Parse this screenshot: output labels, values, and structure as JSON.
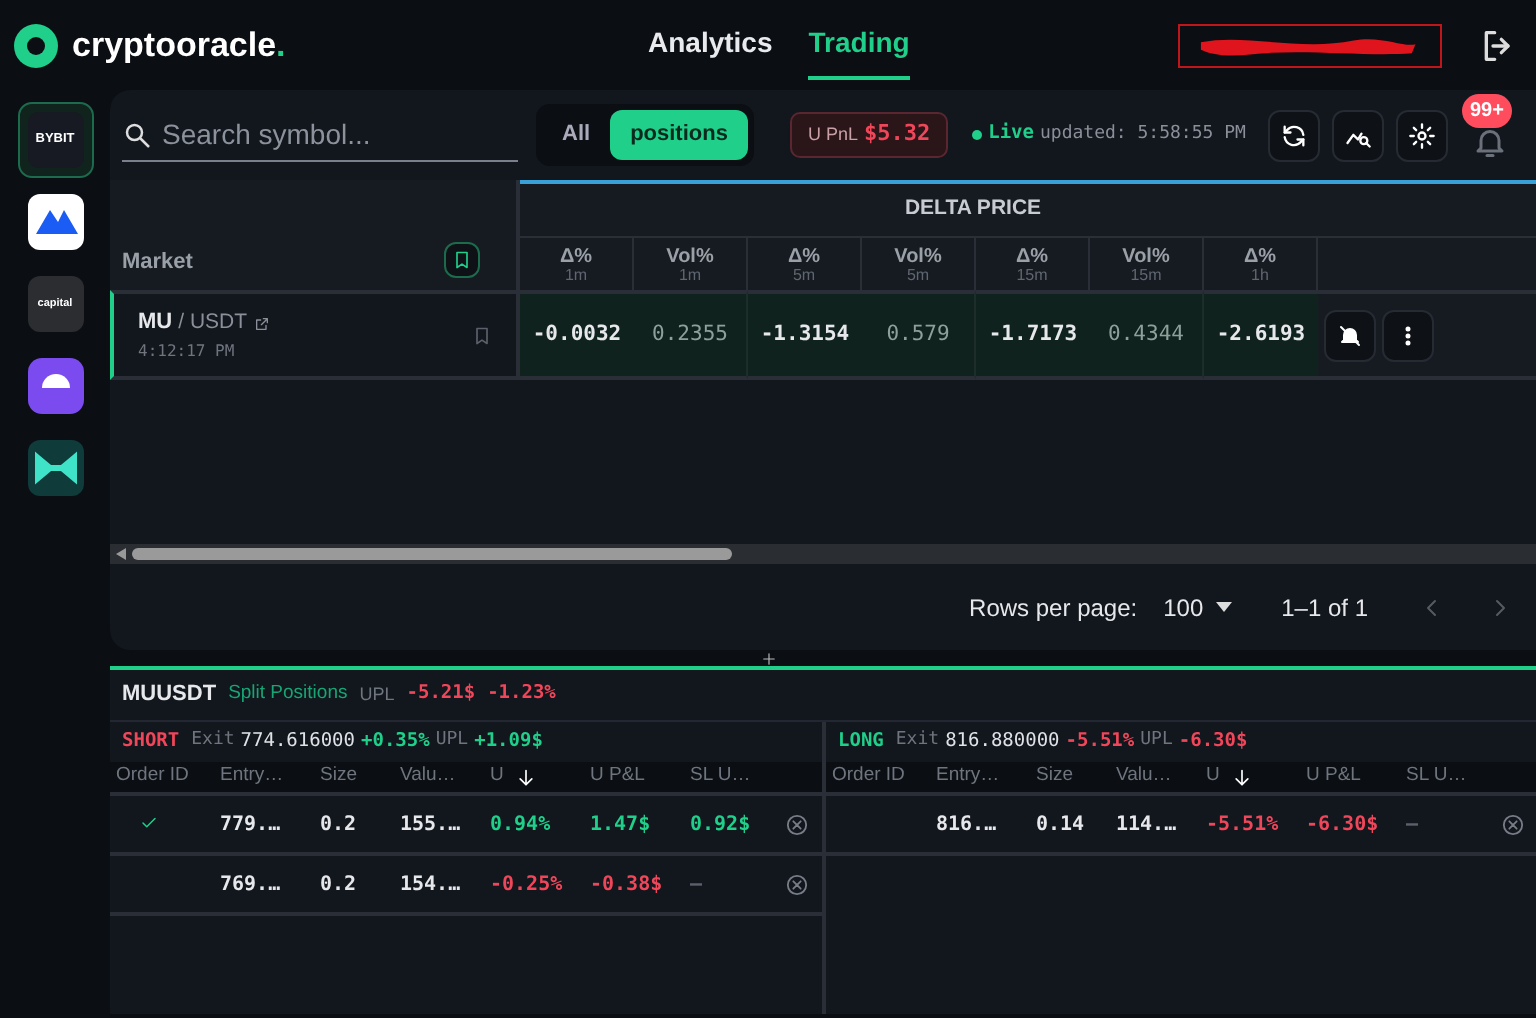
{
  "header": {
    "brand": "cryptooracle",
    "brand_suffix": ".",
    "nav": [
      {
        "label": "Analytics",
        "selected": false
      },
      {
        "label": "Trading",
        "selected": true
      }
    ]
  },
  "exchanges": [
    {
      "kind": "bybit",
      "label": "BYBIT",
      "selected": true
    },
    {
      "kind": "mexc",
      "selected": false
    },
    {
      "kind": "capital",
      "label": "capital",
      "selected": false
    },
    {
      "kind": "kucoin",
      "selected": false
    },
    {
      "kind": "woo",
      "selected": false
    }
  ],
  "toolbar": {
    "search": {
      "placeholder": "Search symbol..."
    },
    "filters": [
      {
        "label": "All",
        "selected": false
      },
      {
        "label": "positions",
        "selected": true
      }
    ],
    "upnl": {
      "label": "U PnL",
      "value": "$5.32"
    },
    "live": {
      "label": "Live",
      "updated": "updated: 5:58:55 PM"
    },
    "notifications": "99+"
  },
  "table": {
    "market_header": "Market",
    "group_header": "DELTA PRICE",
    "columns": [
      {
        "kind": "delta",
        "label": "Δ%",
        "period": "1m"
      },
      {
        "kind": "vol",
        "label": "Vol%",
        "period": "1m"
      },
      {
        "kind": "delta",
        "label": "Δ%",
        "period": "5m"
      },
      {
        "kind": "vol",
        "label": "Vol%",
        "period": "5m"
      },
      {
        "kind": "delta",
        "label": "Δ%",
        "period": "15m"
      },
      {
        "kind": "vol",
        "label": "Vol%",
        "period": "15m"
      },
      {
        "kind": "delta",
        "label": "Δ%",
        "period": "1h"
      }
    ],
    "rows": [
      {
        "symbol": "MU",
        "quote": "/ USDT",
        "time": "4:12:17 PM",
        "selected": true,
        "values": [
          "-0.0032",
          "0.2355",
          "-1.3154",
          "0.579",
          "-1.7173",
          "0.4344",
          "-2.6193"
        ]
      }
    ]
  },
  "pagination": {
    "label": "Rows per page:",
    "per_page": "100",
    "range": "1–1 of 1"
  },
  "positions": {
    "symbol": "MUUSDT",
    "mode": "Split Positions",
    "upl_label": "UPL",
    "upl": "-5.21$",
    "upl_pct": "-1.23%",
    "color": "#f0465a",
    "sides": [
      {
        "side": "SHORT",
        "color": "#f0465a",
        "exit_label": "Exit",
        "exit": "774.616000",
        "exit_pct": {
          "text": "+0.35%",
          "color": "#1fcf8a"
        },
        "upl_label": "UPL",
        "upl": {
          "text": "+1.09$",
          "color": "#1fcf8a"
        },
        "columns": [
          "Order ID",
          "Entry…",
          "Size",
          "Valu…",
          "U",
          "U P&L",
          "SL U…"
        ],
        "rows": [
          {
            "checked": true,
            "entry": "779.…",
            "size": "0.2",
            "value": "155.…",
            "u_pct": "0.94%",
            "u_pnl": "1.47$",
            "sl": {
              "text": "0.92$",
              "color": "#1fcf8a"
            },
            "color": "#1fcf8a"
          },
          {
            "checked": false,
            "entry": "769.…",
            "size": "0.2",
            "value": "154.…",
            "u_pct": "-0.25%",
            "u_pnl": "-0.38$",
            "sl": {
              "text": "—",
              "color": "#5b616b"
            },
            "color": "#f0465a"
          }
        ]
      },
      {
        "side": "LONG",
        "color": "#1fcf8a",
        "exit_label": "Exit",
        "exit": "816.880000",
        "exit_pct": {
          "text": "-5.51%",
          "color": "#f0465a"
        },
        "upl_label": "UPL",
        "upl": {
          "text": "-6.30$",
          "color": "#f0465a"
        },
        "columns": [
          "Order ID",
          "Entry…",
          "Size",
          "Valu…",
          "U",
          "U P&L",
          "SL U…"
        ],
        "rows": [
          {
            "checked": false,
            "entry": "816.…",
            "size": "0.14",
            "value": "114.…",
            "u_pct": "-5.51%",
            "u_pnl": "-6.30$",
            "sl": {
              "text": "—",
              "color": "#5b616b"
            },
            "color": "#f0465a"
          }
        ]
      }
    ]
  }
}
